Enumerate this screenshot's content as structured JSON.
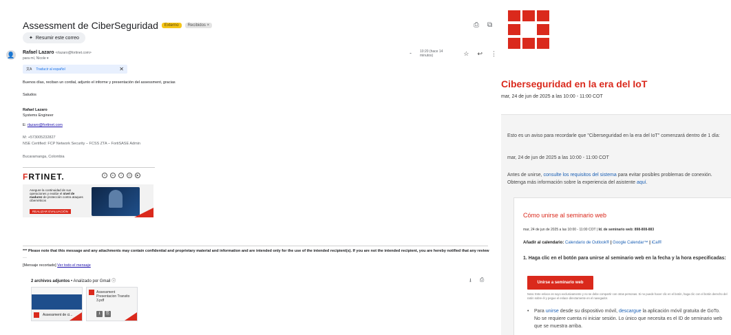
{
  "gmail": {
    "subject": "Assessment de CiberSeguridad",
    "badges": {
      "external": "Externo",
      "inbox": "Recibidos ×"
    },
    "header_icons": {
      "print": "print-icon",
      "open": "open-in-new-icon"
    },
    "summarize": {
      "icon": "sparkle-icon",
      "label": "Resumir este correo"
    },
    "sender": {
      "name": "Rafael Lazaro",
      "address": "<rlazaro@fortinet.com>",
      "to": "para mí, Nicole ▾"
    },
    "time": "10:20 (hace 14 minutos)",
    "translate": {
      "label": "Traducir al español",
      "close": "✕"
    },
    "body": {
      "greeting": "Buenos días, reciban un cordial, adjunto el informe y presentación del assessment, gracias",
      "closing": "Saludos"
    },
    "signature": {
      "name": "Rafael Lazaro",
      "role": "Systems Engineer",
      "email_prefix": "E: ",
      "email": "rlazaro@fortinet.com",
      "mobile": "M: +573005232827",
      "certs": "NSE Certified: FCP Network Security – FCSS ZTA – FortiSASE Admin",
      "city": "Bucaramanga, Colombia",
      "logo_red": "F",
      "logo_rest": "RTINET.",
      "socials": [
        "X",
        "in",
        "f",
        "◎",
        "▶"
      ],
      "banner_text_1": "Asegure la continuidad de sus operaciones y evalúe el ",
      "banner_bold": "nivel de madurez",
      "banner_text_2": " de protección contra ataques cibernéticos",
      "banner_button": "REALIZAR EVALUACIÓN"
    },
    "disclaimer": "*** Please note that this message and any attachments may contain confidential and proprietary material and information and are intended only for the use of the intended recipient(s). If you are not the intended recipient, you are hereby notified that any review",
    "dots": "···",
    "clipped_prefix": "[Mensaje recortado]  ",
    "clipped_link": "Ver todo el mensaje",
    "attachments": {
      "header_bold": "2 archivos adjuntos",
      "header_rest": " • Analizado por Gmail ⓘ",
      "icons": [
        "⭳",
        "⎙"
      ],
      "files": [
        {
          "name": "Assessment de ci..."
        },
        {
          "name": "Assessment Presentacion Transito 3.pdf"
        }
      ],
      "file_actions": [
        "⭳",
        "⎘"
      ]
    }
  },
  "webinar": {
    "title": "Ciberseguridad en la era del IoT",
    "date": "mar, 24 de jun de 2025 a las 10:00 - 11:00 COT",
    "reminder": "Esto es un aviso para recordarle que \"Ciberseguridad en la era del IoT\" comenzará dentro de 1 día:",
    "reminder_date": "mar, 24 de jun de 2025 a las 10:00 - 11:00 COT",
    "requirements_prefix": "Antes de unirse, ",
    "requirements_link": "consulte los requisitos del sistema",
    "requirements_mid": " para evitar posibles problemas de conexión. Obtenga más información sobre la experiencia del asistente ",
    "requirements_here": "aquí",
    "requirements_end": ".",
    "card": {
      "title": "Cómo unirse al seminario web",
      "line_date": "mar, 24 de jun de 2025 a las 10:00 - 11:00 COT | ",
      "line_id": "Id. de seminario web: 898-808-883",
      "calendar_label": "Añadir al calendario: ",
      "calendar_outlook": "Calendario de Outlook®",
      "calendar_sep1": " | ",
      "calendar_google": "Google Calendar™",
      "calendar_sep2": " | ",
      "calendar_ical": "iCal®",
      "step1": "1. Haga clic en el botón para unirse al seminario web en la fecha y la hora especificadas:",
      "join_button": "Unirse a seminario web",
      "note": "Nota: Este enlace es suyo exclusivamente y no se debe compartir con otras personas. Si no puede hacer clic en el botón, haga clic con el botón derecho del ratón sobre él y pegue el enlace directamente en el navegador.",
      "bullet_prefix": "Para ",
      "bullet_link1": "unirse",
      "bullet_mid": " desde su dispositivo móvil, ",
      "bullet_link2": "descargue",
      "bullet_end": " la aplicación móvil gratuita de GoTo. No se requiere cuenta ni iniciar sesión. Lo único que necesita es el ID de seminario web que se muestra arriba."
    }
  },
  "colors": {
    "brand_red": "#da291c",
    "link_blue": "#1a5fb4"
  }
}
